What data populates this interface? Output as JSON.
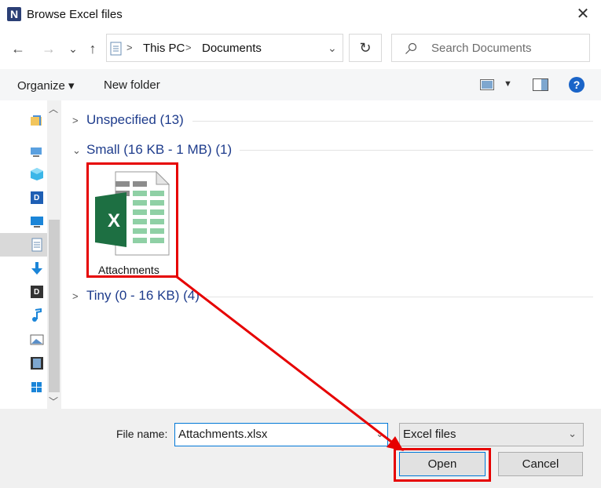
{
  "window": {
    "title": "Browse Excel files",
    "app_icon_letter": "N"
  },
  "nav": {
    "back": "←",
    "forward": "→",
    "recent": "⌄",
    "up": "↑",
    "breadcrumb": [
      "This PC",
      "Documents"
    ],
    "refresh": "↻",
    "search_placeholder": "Search Documents"
  },
  "toolbar": {
    "organize_label": "Organize ▾",
    "new_folder_label": "New folder",
    "help": "?"
  },
  "groups": [
    {
      "title": "Unspecified (13)",
      "expanded": false
    },
    {
      "title": "Small (16 KB - 1 MB) (1)",
      "expanded": true
    },
    {
      "title": "Tiny (0 - 16 KB) (4)",
      "expanded": false
    }
  ],
  "files": [
    {
      "name": "Attachments",
      "icon_letter": "X"
    }
  ],
  "bottom": {
    "file_name_label": "File name:",
    "file_name_value": "Attachments.xlsx",
    "file_type_value": "Excel files",
    "open_label": "Open",
    "cancel_label": "Cancel"
  },
  "colors": {
    "group_title": "#1e3c8c",
    "highlight": "#e60000",
    "excel_green": "#1d6f42"
  }
}
